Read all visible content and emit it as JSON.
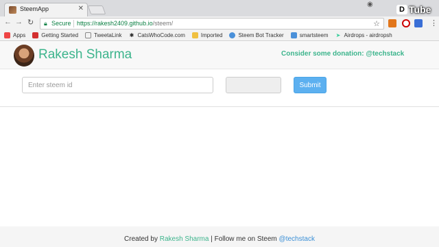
{
  "browser": {
    "tab_title": "SteemApp",
    "secure_label": "Secure",
    "url_host": "https://rakesh2409.github.io",
    "url_path": "/steem/",
    "bookmarks": [
      {
        "label": "Apps",
        "icon": "apps-grid-icon",
        "color": "#e44"
      },
      {
        "label": "Getting Started",
        "icon": "red-shield-icon",
        "color": "#d32f2f"
      },
      {
        "label": "TweetaLink",
        "icon": "page-icon",
        "color": "#888"
      },
      {
        "label": "CatsWhoCode.com",
        "icon": "paw-icon",
        "color": "#222"
      },
      {
        "label": "Imported",
        "icon": "folder-icon",
        "color": "#f0c040"
      },
      {
        "label": "Steem Bot Tracker",
        "icon": "steem-icon",
        "color": "#4a90d9"
      },
      {
        "label": "smartsteem",
        "icon": "smartsteem-icon",
        "color": "#4a90d9"
      },
      {
        "label": "Airdrops - airdropsh",
        "icon": "leaf-icon",
        "color": "#3c9"
      }
    ],
    "overlay_brand": "Tube",
    "overlay_logo": "D"
  },
  "navbar": {
    "brand": "Rakesh Sharma",
    "donation": "Consider some donation: @techstack"
  },
  "form": {
    "placeholder": "Enter steem id",
    "submit_label": "Submit"
  },
  "footer": {
    "prefix": "Created by ",
    "author": "Rakesh Sharma",
    "middle": " | Follow me on Steem ",
    "handle": "@techstack"
  },
  "colors": {
    "brand_green": "#3cb48c",
    "submit_blue": "#5cb0f0",
    "link_blue": "#3a8fd6"
  }
}
